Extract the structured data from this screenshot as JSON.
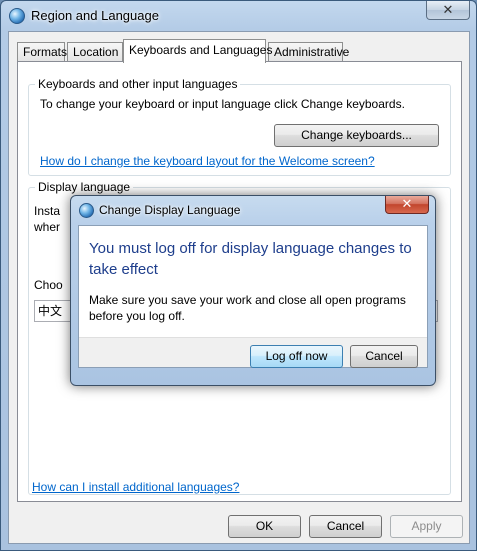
{
  "window": {
    "title": "Region and Language",
    "close_glyph": "✕"
  },
  "tabs": [
    {
      "label": "Formats"
    },
    {
      "label": "Location"
    },
    {
      "label": "Keyboards and Languages"
    },
    {
      "label": "Administrative"
    }
  ],
  "keyboards_group": {
    "legend": "Keyboards and other input languages",
    "instruction": "To change your keyboard or input language click Change keyboards.",
    "change_keyboards_label": "Change keyboards...",
    "welcome_link": "How do I change the keyboard layout for the Welcome screen?"
  },
  "display_group": {
    "legend": "Display language",
    "install_text_line1": "Insta",
    "install_text_line2": "wher",
    "choose_text": "Choo",
    "selected_language": "中文"
  },
  "install_languages_link": "How can I install additional languages?",
  "footer": {
    "ok_label": "OK",
    "cancel_label": "Cancel",
    "apply_label": "Apply"
  },
  "dialog": {
    "title": "Change Display Language",
    "close_glyph": "✕",
    "main_instruction": "You must log off for display language changes to take effect",
    "content": "Make sure you save your work and close all open programs before you log off.",
    "log_off_label": "Log off now",
    "cancel_label": "Cancel"
  }
}
